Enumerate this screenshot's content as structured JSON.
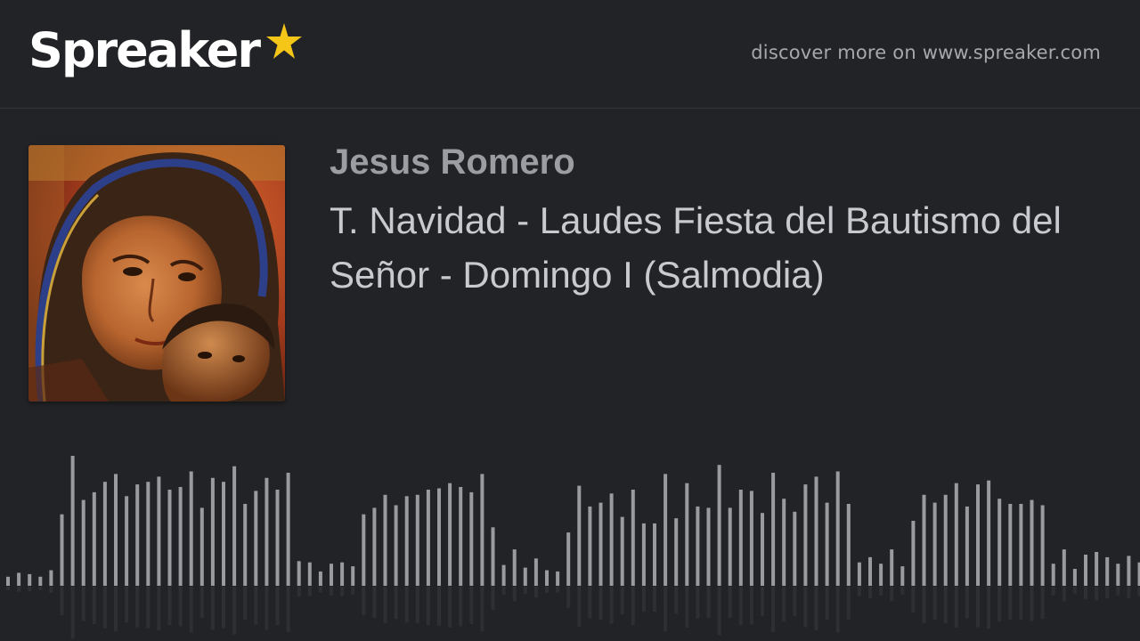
{
  "header": {
    "logo_text": "Spreaker",
    "logo_icon": "star-icon",
    "discover_text": "discover more on www.spreaker.com"
  },
  "episode": {
    "author": "Jesus Romero",
    "title": "T. Navidad - Laudes Fiesta del Bautismo del Señor - Domingo I (Salmodia)",
    "cover_art": "icon-virgin-and-child-image"
  },
  "waveform": {
    "bar_color": "#9a9b9f",
    "reflection_color": "#2e2f33",
    "levels": [
      0.07,
      0.1,
      0.09,
      0.07,
      0.12,
      0.55,
      1.0,
      0.66,
      0.72,
      0.8,
      0.86,
      0.69,
      0.78,
      0.8,
      0.84,
      0.74,
      0.76,
      0.88,
      0.6,
      0.83,
      0.8,
      0.92,
      0.63,
      0.73,
      0.83,
      0.74,
      0.87,
      0.19,
      0.18,
      0.11,
      0.17,
      0.18,
      0.15,
      0.55,
      0.6,
      0.7,
      0.62,
      0.69,
      0.7,
      0.74,
      0.75,
      0.79,
      0.76,
      0.72,
      0.86,
      0.45,
      0.16,
      0.28,
      0.14,
      0.21,
      0.12,
      0.11,
      0.41,
      0.77,
      0.61,
      0.64,
      0.71,
      0.53,
      0.74,
      0.48,
      0.48,
      0.86,
      0.52,
      0.79,
      0.61,
      0.6,
      0.93,
      0.6,
      0.74,
      0.73,
      0.56,
      0.87,
      0.67,
      0.57,
      0.78,
      0.84,
      0.64,
      0.88,
      0.63,
      0.18,
      0.22,
      0.17,
      0.28,
      0.15,
      0.5,
      0.7,
      0.64,
      0.7,
      0.79,
      0.61,
      0.78,
      0.81,
      0.67,
      0.63,
      0.63,
      0.66,
      0.62,
      0.17,
      0.28,
      0.13,
      0.24,
      0.26,
      0.22,
      0.17,
      0.23,
      0.18
    ]
  }
}
